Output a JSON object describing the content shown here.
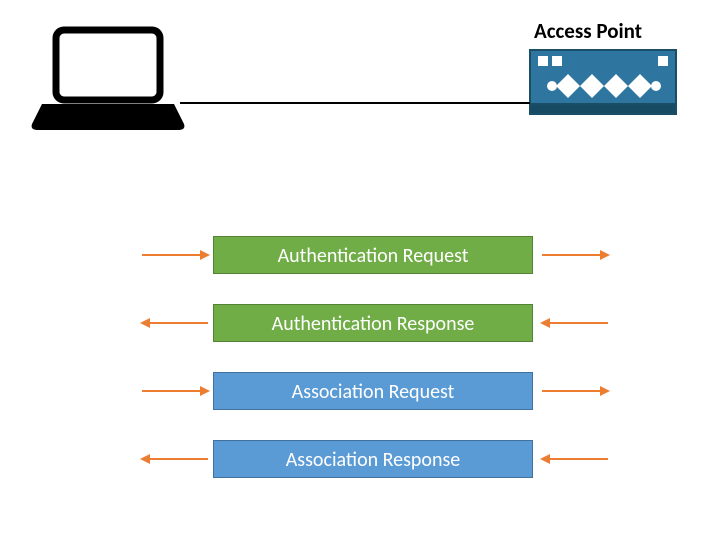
{
  "header": {
    "ap_label": "Access Point"
  },
  "flows": {
    "auth_request": "Authentication Request",
    "auth_response": "Authentication Response",
    "assoc_request": "Association Request",
    "assoc_response": "Association Response"
  },
  "colors": {
    "green_fill": "#70ad47",
    "green_border": "#548235",
    "blue_fill": "#5b9bd5",
    "blue_border": "#41719c",
    "arrow": "#ed7d31",
    "ap_fill": "#1f6e8c"
  }
}
